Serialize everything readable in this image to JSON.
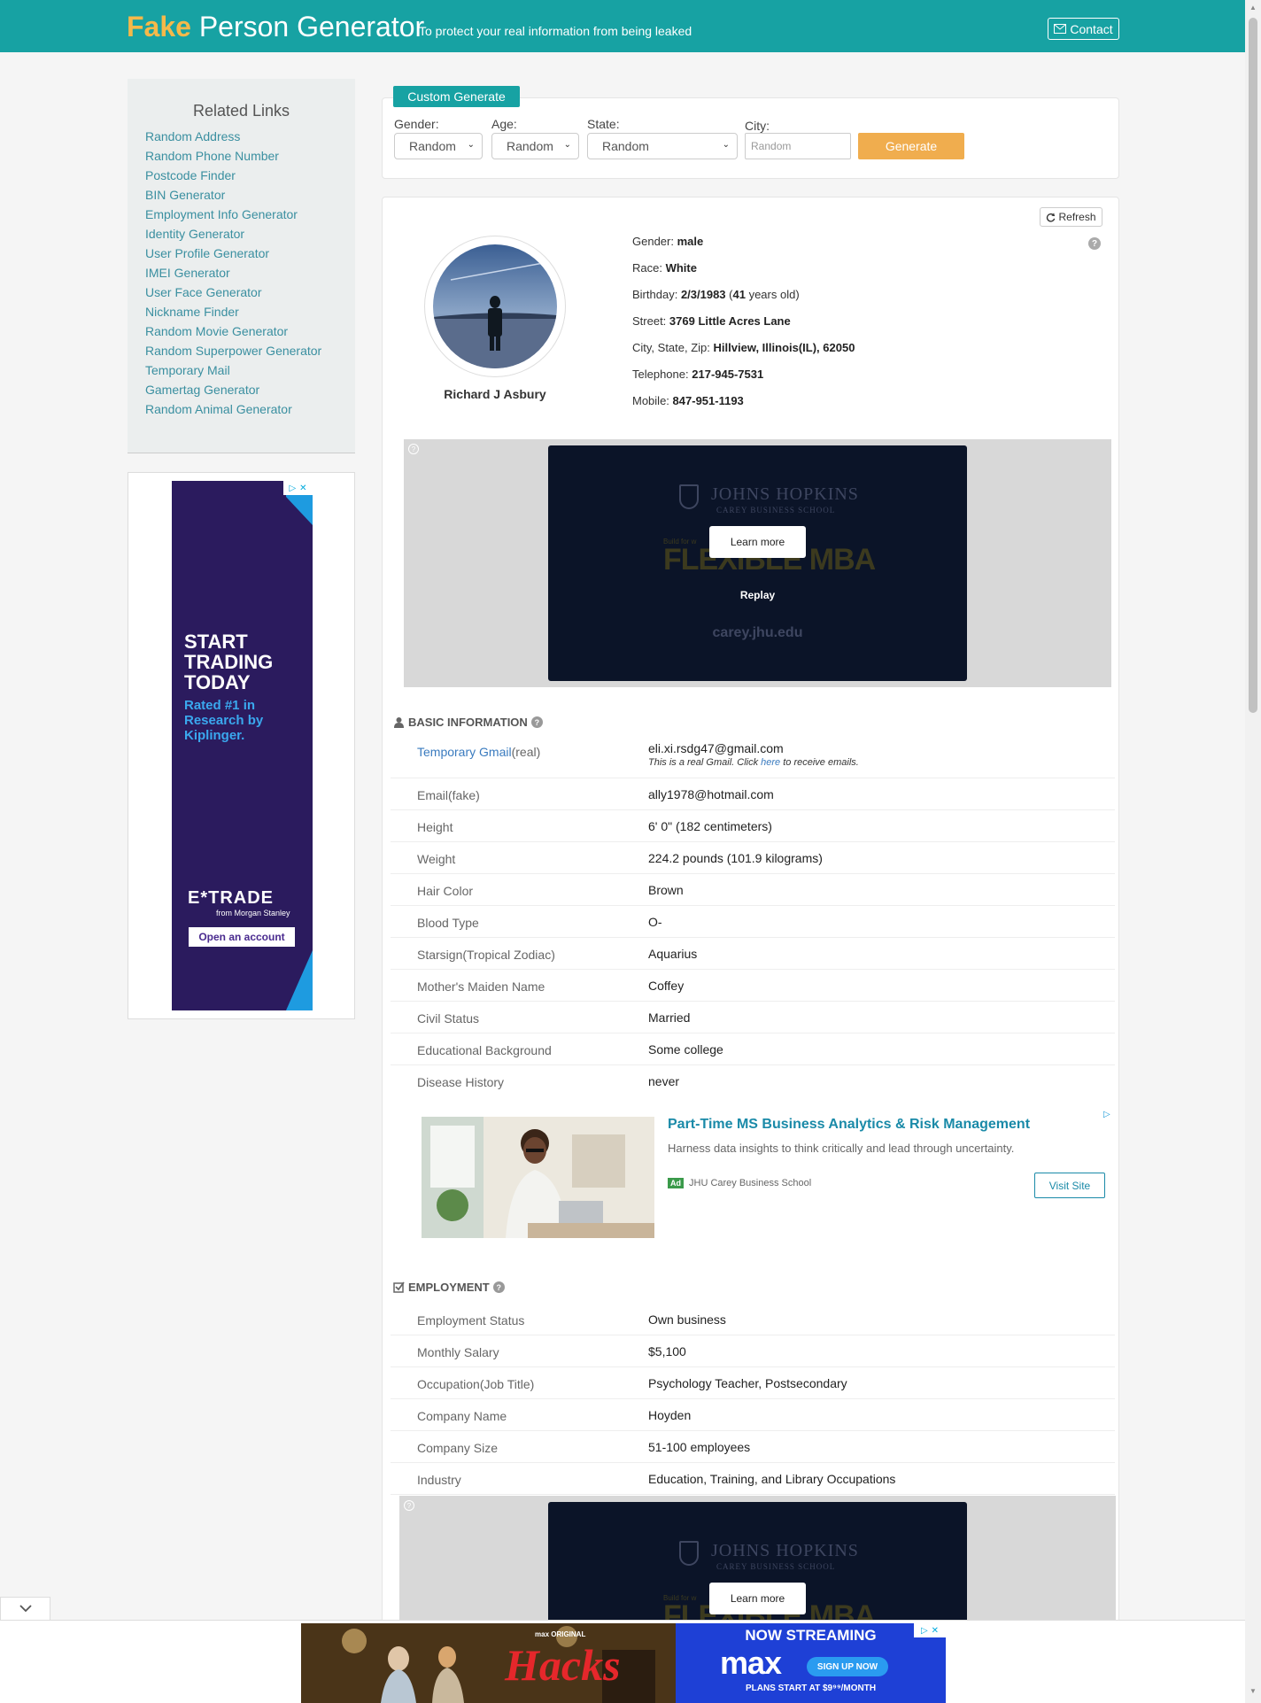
{
  "header": {
    "brand_fake": "Fake",
    "brand_rest": " Person Generator",
    "tagline": "To protect your real information from being leaked",
    "contact_label": "Contact"
  },
  "sidebar": {
    "title": "Related Links",
    "items": [
      {
        "label": "Random Address"
      },
      {
        "label": "Random Phone Number"
      },
      {
        "label": "Postcode Finder"
      },
      {
        "label": "BIN Generator"
      },
      {
        "label": "Employment Info Generator"
      },
      {
        "label": "Identity Generator"
      },
      {
        "label": "User Profile Generator"
      },
      {
        "label": "IMEI Generator"
      },
      {
        "label": "User Face Generator"
      },
      {
        "label": "Nickname Finder"
      },
      {
        "label": "Random Movie Generator"
      },
      {
        "label": "Random Superpower Generator"
      },
      {
        "label": "Temporary Mail"
      },
      {
        "label": "Gamertag Generator"
      },
      {
        "label": "Random Animal Generator"
      }
    ]
  },
  "left_ad": {
    "headline": "START TRADING TODAY",
    "sub": "Rated #1 in Research by Kiplinger.",
    "logo": "E*TRADE",
    "logo_sub": "from Morgan Stanley",
    "cta": "Open an account"
  },
  "custom": {
    "tab_label": "Custom Generate",
    "gender_label": "Gender:",
    "gender_value": "Random",
    "age_label": "Age:",
    "age_value": "Random",
    "state_label": "State:",
    "state_value": "Random",
    "city_label": "City:",
    "city_placeholder": "Random",
    "generate_label": "Generate"
  },
  "profile": {
    "refresh_label": "Refresh",
    "name": "Richard J Asbury",
    "fields": [
      {
        "label": "Gender:",
        "value": "male"
      },
      {
        "label": "Race:",
        "value": "White"
      },
      {
        "label": "Birthday:",
        "value": "2/3/1983",
        "extra_open": " (",
        "age": "41",
        "extra_close": " years old)"
      },
      {
        "label": "Street:",
        "value": "3769 Little Acres Lane"
      },
      {
        "label": "City, State, Zip:",
        "value": "Hillview, Illinois(IL), 62050"
      },
      {
        "label": "Telephone:",
        "value": "217-945-7531"
      },
      {
        "label": "Mobile:",
        "value": "847-951-1193"
      }
    ]
  },
  "video_ad": {
    "brand": "JOHNS HOPKINS",
    "brand_sub": "CAREY BUSINESS SCHOOL",
    "build": "Build for w",
    "mba": "FLEXIBLE MBA",
    "learn_more": "Learn more",
    "replay": "Replay",
    "domain": "carey.jhu.edu"
  },
  "basic": {
    "title": "BASIC INFORMATION",
    "gmail_label": "Temporary Gmail",
    "gmail_real": "(real)",
    "gmail_value": "eli.xi.rsdg47@gmail.com",
    "gmail_note_pre": "This is a real Gmail. Click ",
    "gmail_note_link": "here",
    "gmail_note_post": " to receive emails.",
    "rows": [
      {
        "label": "Email(fake)",
        "value": "ally1978@hotmail.com"
      },
      {
        "label": "Height",
        "value": "6' 0\" (182 centimeters)"
      },
      {
        "label": "Weight",
        "value": "224.2 pounds (101.9 kilograms)"
      },
      {
        "label": "Hair Color",
        "value": "Brown"
      },
      {
        "label": "Blood Type",
        "value": "O-"
      },
      {
        "label": "Starsign(Tropical Zodiac)",
        "value": "Aquarius"
      },
      {
        "label": "Mother's Maiden Name",
        "value": "Coffey"
      },
      {
        "label": "Civil Status",
        "value": "Married"
      },
      {
        "label": "Educational Background",
        "value": "Some college"
      },
      {
        "label": "Disease History",
        "value": "never"
      }
    ]
  },
  "native_ad": {
    "title": "Part-Time MS Business Analytics & Risk Management",
    "desc": "Harness data insights to think critically and lead through uncertainty.",
    "badge": "Ad",
    "advertiser": "JHU Carey Business School",
    "cta": "Visit Site"
  },
  "employment": {
    "title": "EMPLOYMENT",
    "rows": [
      {
        "label": "Employment Status",
        "value": "Own business"
      },
      {
        "label": "Monthly Salary",
        "value": "$5,100"
      },
      {
        "label": "Occupation(Job Title)",
        "value": "Psychology Teacher, Postsecondary"
      },
      {
        "label": "Company Name",
        "value": "Hoyden"
      },
      {
        "label": "Company Size",
        "value": "51-100 employees"
      },
      {
        "label": "Industry",
        "value": "Education, Training, and Library Occupations"
      }
    ]
  },
  "bottom_ad": {
    "max_original": "max ORIGINAL",
    "show": "Hacks",
    "now_streaming": "NOW STREAMING",
    "max_logo": "max",
    "signup": "SIGN UP NOW",
    "plans": "PLANS START AT $9⁹⁹/MONTH"
  },
  "colors": {
    "brand_teal": "#17a2a3",
    "accent_orange": "#f0ad4e",
    "link_teal": "#3a8fa0"
  }
}
